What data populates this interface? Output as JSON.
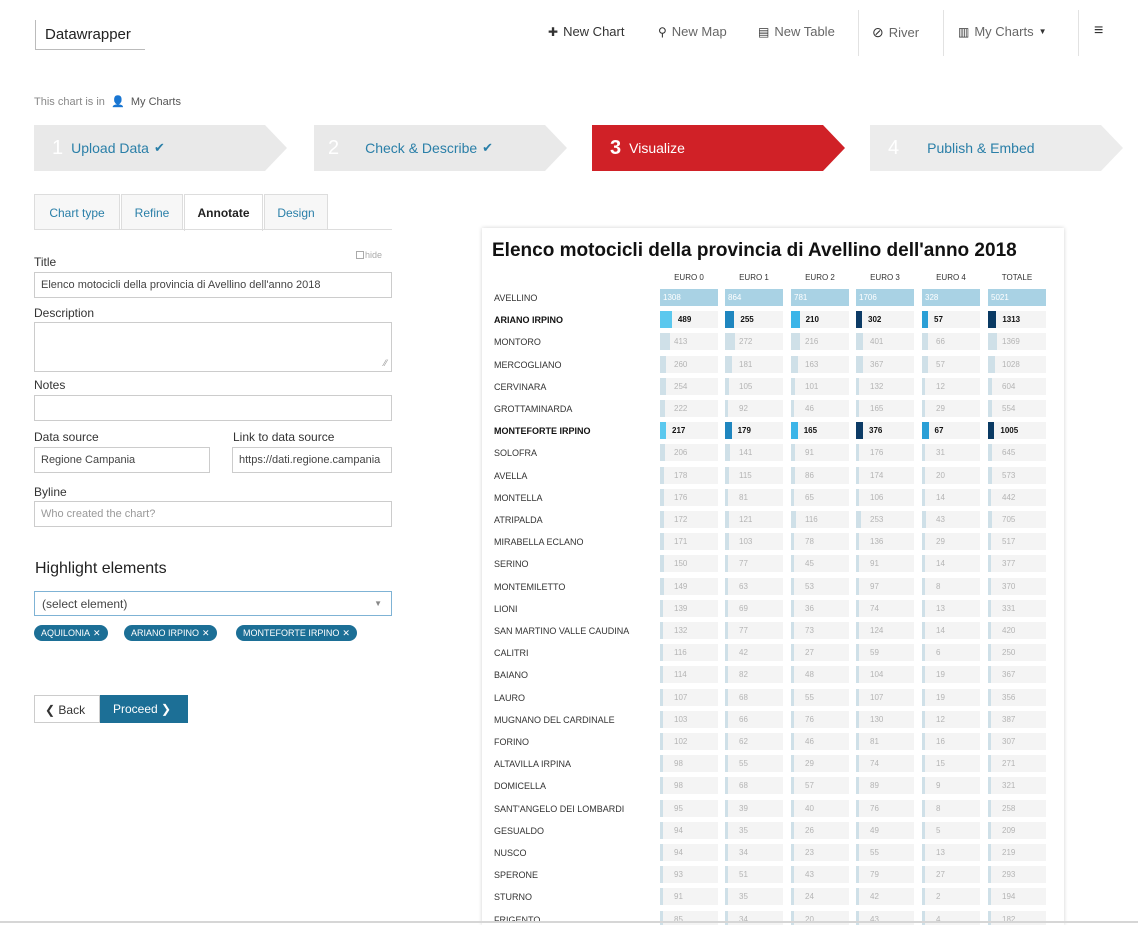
{
  "nav": {
    "logo": "Datawrapper",
    "new_chart": "New Chart",
    "new_map": "New Map",
    "new_table": "New Table",
    "river": "River",
    "my_charts": "My Charts"
  },
  "location": {
    "prefix": "This chart is in",
    "folder": "My Charts"
  },
  "steps": [
    {
      "num": "1",
      "label": "Upload Data",
      "state": "done"
    },
    {
      "num": "2",
      "label": "Check & Describe",
      "state": "done"
    },
    {
      "num": "3",
      "label": "Visualize",
      "state": "current"
    },
    {
      "num": "4",
      "label": "Publish & Embed",
      "state": "todo"
    }
  ],
  "tabs": [
    "Chart type",
    "Refine",
    "Annotate",
    "Design"
  ],
  "active_tab": "Annotate",
  "form": {
    "title_label": "Title",
    "hide_label": "hide",
    "title_value": "Elenco motocicli della provincia di Avellino dell'anno 2018",
    "description_label": "Description",
    "notes_label": "Notes",
    "data_source_label": "Data source",
    "data_source_value": "Regione Campania",
    "link_label": "Link to data source",
    "link_value": "https://dati.regione.campania",
    "byline_label": "Byline",
    "byline_placeholder": "Who created the chart?"
  },
  "highlight": {
    "heading": "Highlight elements",
    "select_value": "(select element)",
    "tags": [
      "AQUILONIA",
      "ARIANO IRPINO",
      "MONTEFORTE IRPINO"
    ]
  },
  "buttons": {
    "back": "Back",
    "proceed": "Proceed"
  },
  "colors": {
    "brand_blue": "#1c6f96",
    "step_red": "#d02127",
    "euro_colors": [
      "#5bc8ee",
      "#1f86bf",
      "#3cb5e8",
      "#0c3b66",
      "#2a9fd6",
      "#0a3a63"
    ]
  },
  "chart_data": {
    "type": "table",
    "title": "Elenco motocicli della provincia di Avellino dell'anno 2018",
    "columns": [
      "EURO 0",
      "EURO 1",
      "EURO 2",
      "EURO 3",
      "EURO 4",
      "TOTALE"
    ],
    "column_max": [
      1308,
      864,
      781,
      1706,
      328,
      5021
    ],
    "rows": [
      {
        "name": "AVELLINO",
        "hl": false,
        "total_row": true,
        "values": [
          1308,
          864,
          781,
          1706,
          328,
          5021
        ]
      },
      {
        "name": "ARIANO IRPINO",
        "hl": true,
        "values": [
          489,
          255,
          210,
          302,
          57,
          1313
        ]
      },
      {
        "name": "MONTORO",
        "hl": false,
        "values": [
          413,
          272,
          216,
          401,
          66,
          1369
        ]
      },
      {
        "name": "MERCOGLIANO",
        "hl": false,
        "values": [
          260,
          181,
          163,
          367,
          57,
          1028
        ]
      },
      {
        "name": "CERVINARA",
        "hl": false,
        "values": [
          254,
          105,
          101,
          132,
          12,
          604
        ]
      },
      {
        "name": "GROTTAMINARDA",
        "hl": false,
        "values": [
          222,
          92,
          46,
          165,
          29,
          554
        ]
      },
      {
        "name": "MONTEFORTE IRPINO",
        "hl": true,
        "values": [
          217,
          179,
          165,
          376,
          67,
          1005
        ]
      },
      {
        "name": "SOLOFRA",
        "hl": false,
        "values": [
          206,
          141,
          91,
          176,
          31,
          645
        ]
      },
      {
        "name": "AVELLA",
        "hl": false,
        "values": [
          178,
          115,
          86,
          174,
          20,
          573
        ]
      },
      {
        "name": "MONTELLA",
        "hl": false,
        "values": [
          176,
          81,
          65,
          106,
          14,
          442
        ]
      },
      {
        "name": "ATRIPALDA",
        "hl": false,
        "values": [
          172,
          121,
          116,
          253,
          43,
          705
        ]
      },
      {
        "name": "MIRABELLA ECLANO",
        "hl": false,
        "values": [
          171,
          103,
          78,
          136,
          29,
          517
        ]
      },
      {
        "name": "SERINO",
        "hl": false,
        "values": [
          150,
          77,
          45,
          91,
          14,
          377
        ]
      },
      {
        "name": "MONTEMILETTO",
        "hl": false,
        "values": [
          149,
          63,
          53,
          97,
          8,
          370
        ]
      },
      {
        "name": "LIONI",
        "hl": false,
        "values": [
          139,
          69,
          36,
          74,
          13,
          331
        ]
      },
      {
        "name": "SAN MARTINO VALLE CAUDINA",
        "hl": false,
        "values": [
          132,
          77,
          73,
          124,
          14,
          420
        ]
      },
      {
        "name": "CALITRI",
        "hl": false,
        "values": [
          116,
          42,
          27,
          59,
          6,
          250
        ]
      },
      {
        "name": "BAIANO",
        "hl": false,
        "values": [
          114,
          82,
          48,
          104,
          19,
          367
        ]
      },
      {
        "name": "LAURO",
        "hl": false,
        "values": [
          107,
          68,
          55,
          107,
          19,
          356
        ]
      },
      {
        "name": "MUGNANO DEL CARDINALE",
        "hl": false,
        "values": [
          103,
          66,
          76,
          130,
          12,
          387
        ]
      },
      {
        "name": "FORINO",
        "hl": false,
        "values": [
          102,
          62,
          46,
          81,
          16,
          307
        ]
      },
      {
        "name": "ALTAVILLA IRPINA",
        "hl": false,
        "values": [
          98,
          55,
          29,
          74,
          15,
          271
        ]
      },
      {
        "name": "DOMICELLA",
        "hl": false,
        "values": [
          98,
          68,
          57,
          89,
          9,
          321
        ]
      },
      {
        "name": "SANT'ANGELO DEI LOMBARDI",
        "hl": false,
        "values": [
          95,
          39,
          40,
          76,
          8,
          258
        ]
      },
      {
        "name": "GESUALDO",
        "hl": false,
        "values": [
          94,
          35,
          26,
          49,
          5,
          209
        ]
      },
      {
        "name": "NUSCO",
        "hl": false,
        "values": [
          94,
          34,
          23,
          55,
          13,
          219
        ]
      },
      {
        "name": "SPERONE",
        "hl": false,
        "values": [
          93,
          51,
          43,
          79,
          27,
          293
        ]
      },
      {
        "name": "STURNO",
        "hl": false,
        "values": [
          91,
          35,
          24,
          42,
          2,
          194
        ]
      },
      {
        "name": "FRIGENTO",
        "hl": false,
        "values": [
          85,
          34,
          20,
          43,
          4,
          182
        ]
      }
    ]
  }
}
